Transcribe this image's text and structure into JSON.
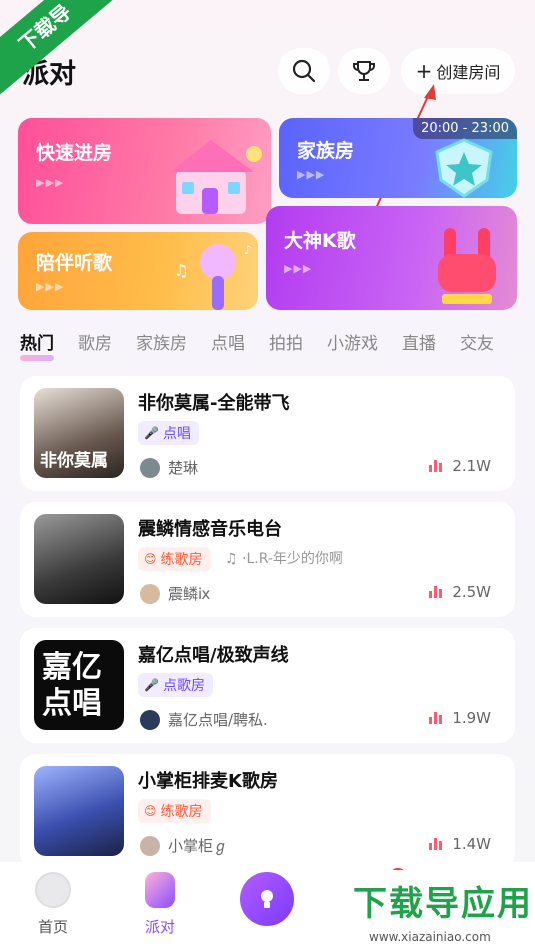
{
  "watermark": {
    "corner_text": "下载导",
    "brand_text": "下载导应用",
    "url_text": "www.xiazainiao.com"
  },
  "header": {
    "title": "派对",
    "create_label": "创建房间",
    "create_plus": "+"
  },
  "banners": {
    "quick": {
      "label": "快速进房"
    },
    "family": {
      "label": "家族房",
      "time": "20:00 - 23:00"
    },
    "listen": {
      "label": "陪伴听歌"
    },
    "god": {
      "label": "大神K歌"
    },
    "arrows": "▶▶▶"
  },
  "tabs": [
    "热门",
    "歌房",
    "家族房",
    "点唱",
    "拍拍",
    "小游戏",
    "直播",
    "交友"
  ],
  "rooms": [
    {
      "title": "非你莫属-全能带飞",
      "tag": "点唱",
      "tag_style": "purple",
      "song": "",
      "host": "楚琳",
      "heat": "2.1W",
      "thumb_text": "非你莫属"
    },
    {
      "title": "震鳞情感音乐电台",
      "tag": "练歌房",
      "tag_style": "red",
      "song": "♫ ·L.R-年少的你啊",
      "host": "震鳞ⅸ",
      "heat": "2.5W",
      "thumb_text": ""
    },
    {
      "title": "嘉亿点唱/极致声线",
      "tag": "点歌房",
      "tag_style": "purple",
      "song": "",
      "host": "嘉亿点唱/聘私.",
      "heat": "1.9W",
      "thumb_text": "嘉亿点唱"
    },
    {
      "title": "小掌柜排麦K歌房",
      "tag": "练歌房",
      "tag_style": "red",
      "song": "",
      "host": "小掌柜ℊ",
      "heat": "1.4W",
      "thumb_text": ""
    }
  ],
  "bottom_nav": {
    "home": "首页",
    "party": "派对",
    "msg_badge": "4"
  },
  "colors": {
    "accent": "#b35cff",
    "heat": "#ff5a70",
    "watermark_green": "#1fa34a"
  }
}
